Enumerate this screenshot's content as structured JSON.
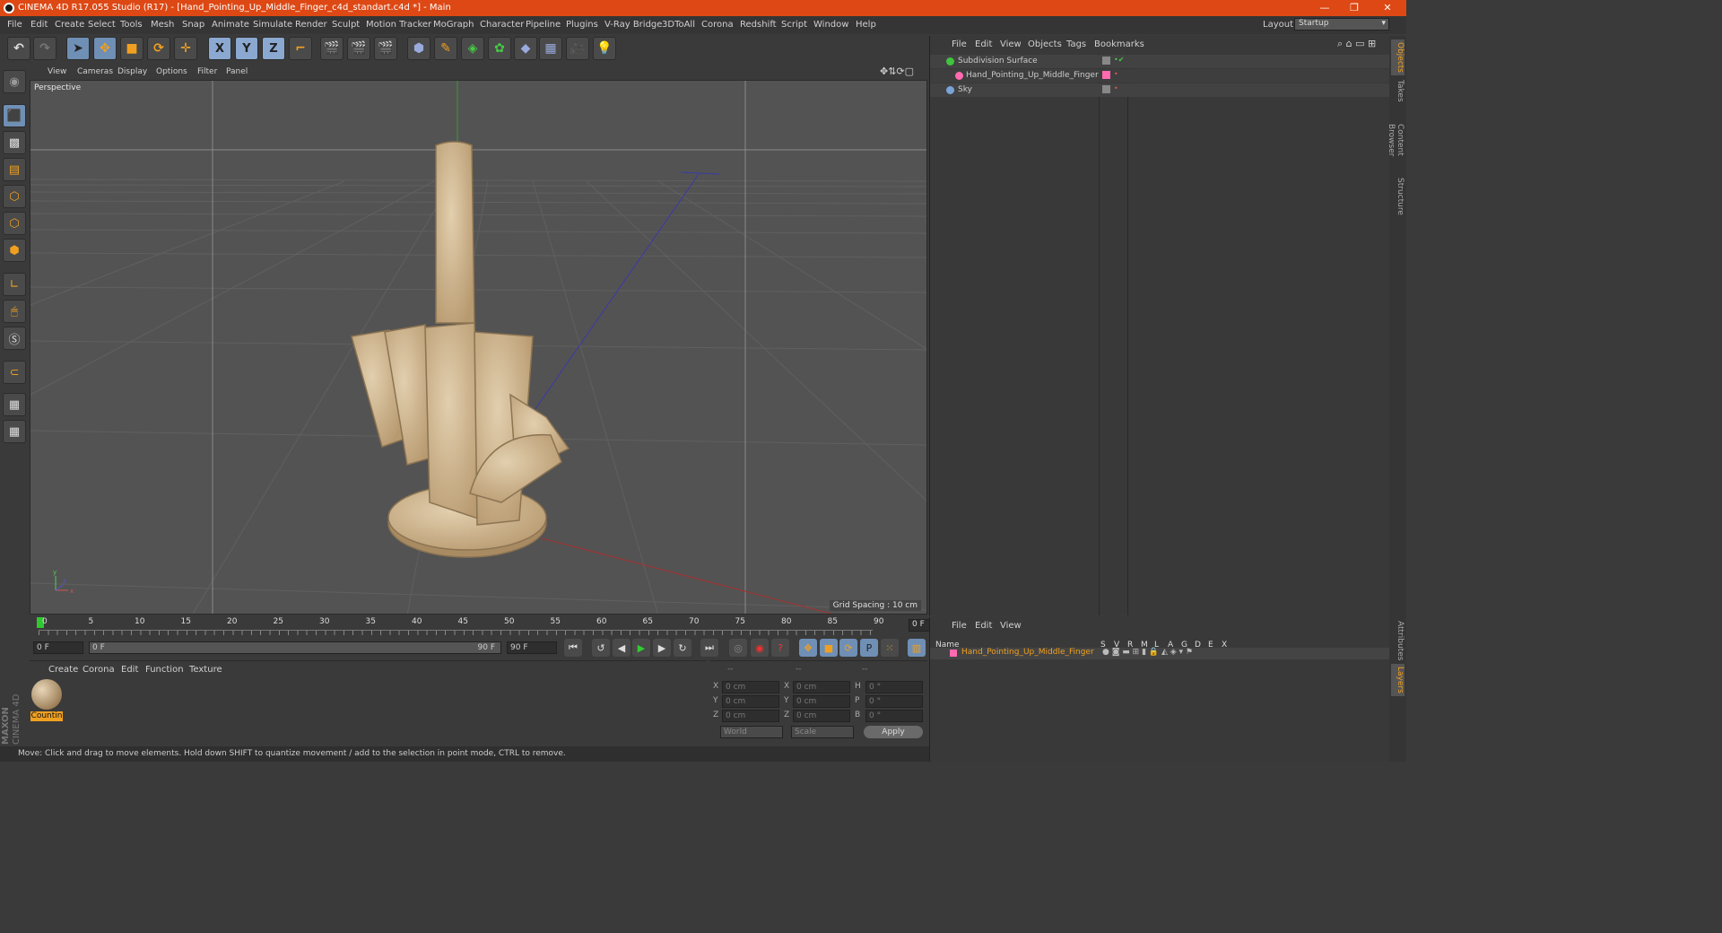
{
  "window": {
    "title": "CINEMA 4D R17.055 Studio (R17) - [Hand_Pointing_Up_Middle_Finger_c4d_standart.c4d *] - Main"
  },
  "menu": [
    "File",
    "Edit",
    "Create",
    "Select",
    "Tools",
    "Mesh",
    "Snap",
    "Animate",
    "Simulate",
    "Render",
    "Sculpt",
    "Motion Tracker",
    "MoGraph",
    "Character",
    "Pipeline",
    "Plugins",
    "V-Ray Bridge",
    "3DToAll",
    "Corona",
    "Redshift",
    "Script",
    "Window",
    "Help"
  ],
  "layout": {
    "label": "Layout:",
    "value": "Startup"
  },
  "toolbar": {
    "x": "X",
    "y": "Y",
    "z": "Z"
  },
  "viewport": {
    "menu": [
      "View",
      "Cameras",
      "Display",
      "Options",
      "Filter",
      "Panel"
    ],
    "label": "Perspective",
    "grid_spacing": "Grid Spacing : 10 cm"
  },
  "timeline": {
    "ticks": [
      "0",
      "5",
      "10",
      "15",
      "20",
      "25",
      "30",
      "35",
      "40",
      "45",
      "50",
      "55",
      "60",
      "65",
      "70",
      "75",
      "80",
      "85",
      "90"
    ],
    "frame": "0 F",
    "start": "0 F",
    "range_start": "0 F",
    "range_end": "90 F",
    "end": "90 F"
  },
  "material_manager": {
    "menu": [
      "Create",
      "Corona",
      "Edit",
      "Function",
      "Texture"
    ],
    "material_name": "Countin"
  },
  "attributes": {
    "header": [
      "--",
      "--",
      "--"
    ],
    "rows": [
      {
        "a": "X",
        "av": "0 cm",
        "b": "X",
        "bv": "0 cm",
        "c": "H",
        "cv": "0 °"
      },
      {
        "a": "Y",
        "av": "0 cm",
        "b": "Y",
        "bv": "0 cm",
        "c": "P",
        "cv": "0 °"
      },
      {
        "a": "Z",
        "av": "0 cm",
        "b": "Z",
        "bv": "0 cm",
        "c": "B",
        "cv": "0 °"
      }
    ],
    "coord_mode": "World",
    "size_mode": "Scale",
    "apply": "Apply"
  },
  "status": "Move: Click and drag to move elements. Hold down SHIFT to quantize movement / add to the selection in point mode, CTRL to remove.",
  "object_manager": {
    "menu": [
      "File",
      "Edit",
      "View",
      "Objects",
      "Tags",
      "Bookmarks"
    ],
    "objects": [
      {
        "name": "Subdivision Surface",
        "color": "#3fc43f"
      },
      {
        "name": "Hand_Pointing_Up_Middle_Finger",
        "color": "#ff6ab0"
      },
      {
        "name": "Sky",
        "color": "#7aa3d8"
      }
    ]
  },
  "layer_manager": {
    "menu": [
      "File",
      "Edit",
      "View"
    ],
    "columns": [
      "Name",
      "S",
      "V",
      "R",
      "M",
      "L",
      "A",
      "G",
      "D",
      "E",
      "X"
    ],
    "layer": "Hand_Pointing_Up_Middle_Finger"
  },
  "side_tabs": [
    "Objects",
    "Takes",
    "Content Browser",
    "Structure",
    "Attributes",
    "Layers"
  ],
  "brand": {
    "maxon": "MAXON",
    "c4d": "CINEMA 4D"
  }
}
